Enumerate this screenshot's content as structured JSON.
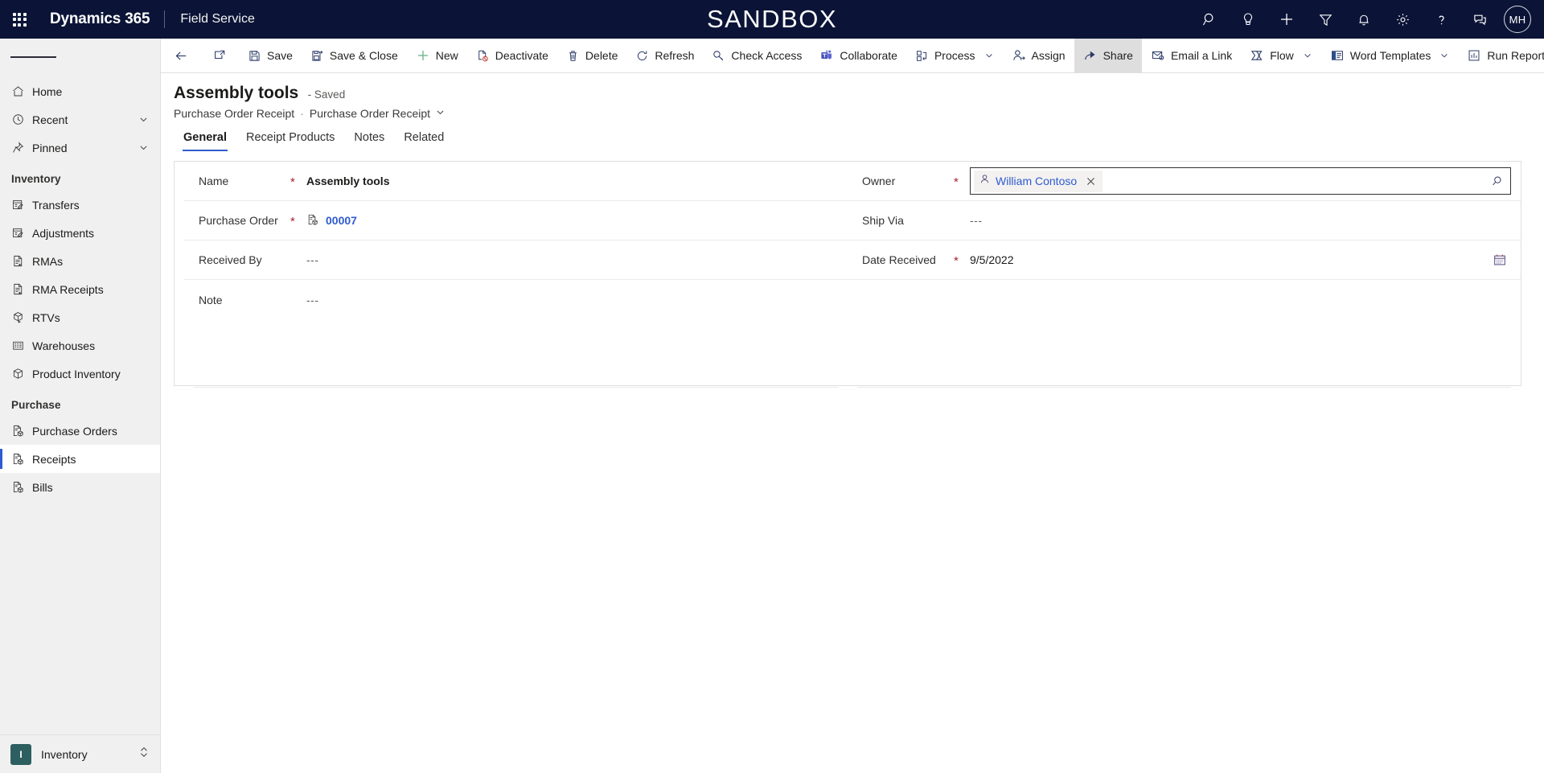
{
  "topnav": {
    "waffle_label": "app-launcher",
    "brand": "Dynamics 365",
    "app_name": "Field Service",
    "environment_banner": "SANDBOX",
    "icons": [
      {
        "name": "search-icon",
        "label": "Search"
      },
      {
        "name": "lightbulb-icon",
        "label": "Ideas"
      },
      {
        "name": "plus-icon",
        "label": "Quick create"
      },
      {
        "name": "filter-icon",
        "label": "Filter"
      },
      {
        "name": "bell-icon",
        "label": "Notifications"
      },
      {
        "name": "gear-icon",
        "label": "Settings"
      },
      {
        "name": "question-icon",
        "label": "Help"
      },
      {
        "name": "feedback-icon",
        "label": "Feedback"
      }
    ],
    "avatar_initials": "MH"
  },
  "sidebar": {
    "hamburger_label": "Site map",
    "items": [
      {
        "label": "Home",
        "icon": "home-icon",
        "chevron": false,
        "selected": false
      },
      {
        "label": "Recent",
        "icon": "clock-icon",
        "chevron": true,
        "selected": false
      },
      {
        "label": "Pinned",
        "icon": "pin-icon",
        "chevron": true,
        "selected": false
      }
    ],
    "groups": [
      {
        "title": "Inventory",
        "items": [
          {
            "label": "Transfers",
            "icon": "transfer-icon",
            "selected": false
          },
          {
            "label": "Adjustments",
            "icon": "adjustment-icon",
            "selected": false
          },
          {
            "label": "RMAs",
            "icon": "rma-icon",
            "selected": false
          },
          {
            "label": "RMA Receipts",
            "icon": "rma-receipt-icon",
            "selected": false
          },
          {
            "label": "RTVs",
            "icon": "rtv-icon",
            "selected": false
          },
          {
            "label": "Warehouses",
            "icon": "warehouse-icon",
            "selected": false
          },
          {
            "label": "Product Inventory",
            "icon": "box-icon",
            "selected": false
          }
        ]
      },
      {
        "title": "Purchase",
        "items": [
          {
            "label": "Purchase Orders",
            "icon": "purchase-order-icon",
            "selected": false
          },
          {
            "label": "Receipts",
            "icon": "receipt-icon",
            "selected": true
          },
          {
            "label": "Bills",
            "icon": "bill-icon",
            "selected": false
          }
        ]
      }
    ],
    "area_switcher": {
      "badge": "I",
      "label": "Inventory"
    }
  },
  "commandbar": {
    "back_label": "Back",
    "popout_label": "Open in new window",
    "buttons": [
      {
        "label": "Save",
        "icon": "save-icon",
        "caret": false,
        "active": false
      },
      {
        "label": "Save & Close",
        "icon": "save-close-icon",
        "caret": false,
        "active": false
      },
      {
        "label": "New",
        "icon": "plus-icon",
        "caret": false,
        "active": false
      },
      {
        "label": "Deactivate",
        "icon": "deactivate-icon",
        "caret": false,
        "active": false
      },
      {
        "label": "Delete",
        "icon": "trash-icon",
        "caret": false,
        "active": false
      },
      {
        "label": "Refresh",
        "icon": "refresh-icon",
        "caret": false,
        "active": false
      },
      {
        "label": "Check Access",
        "icon": "key-icon",
        "caret": false,
        "active": false
      },
      {
        "label": "Collaborate",
        "icon": "teams-icon",
        "caret": false,
        "active": false
      },
      {
        "label": "Process",
        "icon": "process-icon",
        "caret": true,
        "active": false
      },
      {
        "label": "Assign",
        "icon": "assign-icon",
        "caret": false,
        "active": false
      },
      {
        "label": "Share",
        "icon": "share-icon",
        "caret": false,
        "active": true
      },
      {
        "label": "Email a Link",
        "icon": "email-link-icon",
        "caret": false,
        "active": false
      },
      {
        "label": "Flow",
        "icon": "flow-icon",
        "caret": true,
        "active": false
      },
      {
        "label": "Word Templates",
        "icon": "word-icon",
        "caret": true,
        "active": false
      },
      {
        "label": "Run Report",
        "icon": "report-icon",
        "caret": true,
        "active": false
      }
    ]
  },
  "record": {
    "title": "Assembly tools",
    "status": "- Saved",
    "breadcrumb_entity": "Purchase Order Receipt",
    "breadcrumb_sep": "·",
    "breadcrumb_form": "Purchase Order Receipt"
  },
  "tabs": [
    {
      "label": "General",
      "selected": true
    },
    {
      "label": "Receipt Products",
      "selected": false
    },
    {
      "label": "Notes",
      "selected": false
    },
    {
      "label": "Related",
      "selected": false
    }
  ],
  "form": {
    "left": [
      {
        "label": "Name",
        "required": true,
        "value": "Assembly tools",
        "style": "bold"
      },
      {
        "label": "Purchase Order",
        "required": true,
        "value": "00007",
        "style": "link",
        "icon": "purchase-order-icon"
      },
      {
        "label": "Received By",
        "required": false,
        "value": "---",
        "style": "empty"
      },
      {
        "label": "Note",
        "required": false,
        "value": "---",
        "style": "empty"
      }
    ],
    "right": [
      {
        "label": "Owner",
        "required": true,
        "value": "William Contoso",
        "style": "lookup-active",
        "icon": "person-icon"
      },
      {
        "label": "Ship Via",
        "required": false,
        "value": "---",
        "style": "empty"
      },
      {
        "label": "Date Received",
        "required": true,
        "value": "9/5/2022",
        "style": "date",
        "icon": "calendar-icon"
      }
    ]
  },
  "colors": {
    "nav_bg": "#0b1437",
    "accent": "#2f5bd0",
    "required_asterisk": "#a4262c",
    "area_badge": "#2d5f60",
    "sidebar_bg": "#f0f0f0"
  }
}
